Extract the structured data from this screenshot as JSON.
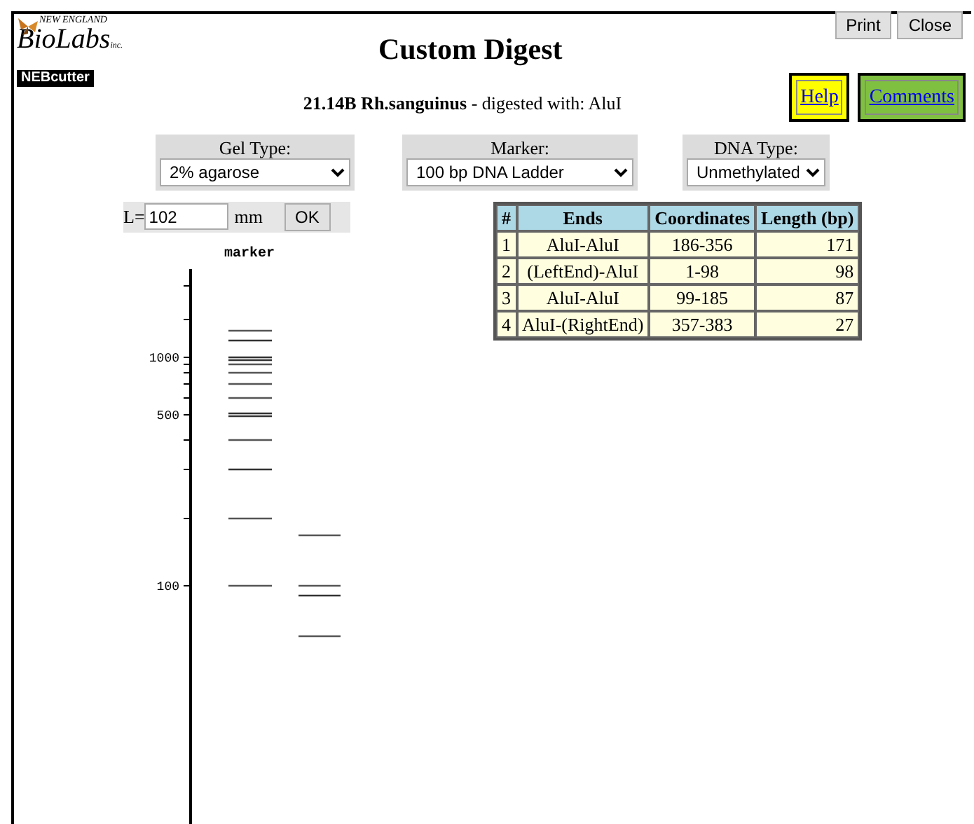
{
  "logo": {
    "line1": "NEW ENGLAND",
    "line2": "BioLabs",
    "line2_suffix": "inc.",
    "badge": "NEBcutter"
  },
  "title": "Custom Digest",
  "buttons": [
    "Print",
    "Close"
  ],
  "subtitle": {
    "text": "**21.14B Rh.sanguinus** - digested with: AluI"
  },
  "links": [
    {
      "label": "Help",
      "color": "#ffff00"
    },
    {
      "label": "Comments",
      "color": "#80c040"
    }
  ],
  "selectors": [
    {
      "label": "Gel Type:",
      "value": "2% agarose"
    },
    {
      "label": "Marker:",
      "value": "100 bp DNA Ladder"
    },
    {
      "label": "DNA Type:",
      "value": "Unmethylated"
    }
  ],
  "length": {
    "prefix": "L=",
    "value": "102",
    "unit": "mm",
    "button": "OK"
  },
  "table": {
    "columns": [
      "#",
      "Ends",
      "Coordinates",
      "Length (bp)"
    ],
    "rows": [
      [
        "1",
        "AluI-AluI",
        "186-356",
        "171"
      ],
      [
        "2",
        "(LeftEnd)-AluI",
        "1-98",
        "98"
      ],
      [
        "3",
        "AluI-AluI",
        "99-185",
        "87"
      ],
      [
        "4",
        "AluI-(RightEnd)",
        "357-383",
        "27"
      ]
    ]
  },
  "gel": {
    "lane_label": "marker",
    "axis_labels": [
      "1000",
      "500",
      "100"
    ]
  }
}
